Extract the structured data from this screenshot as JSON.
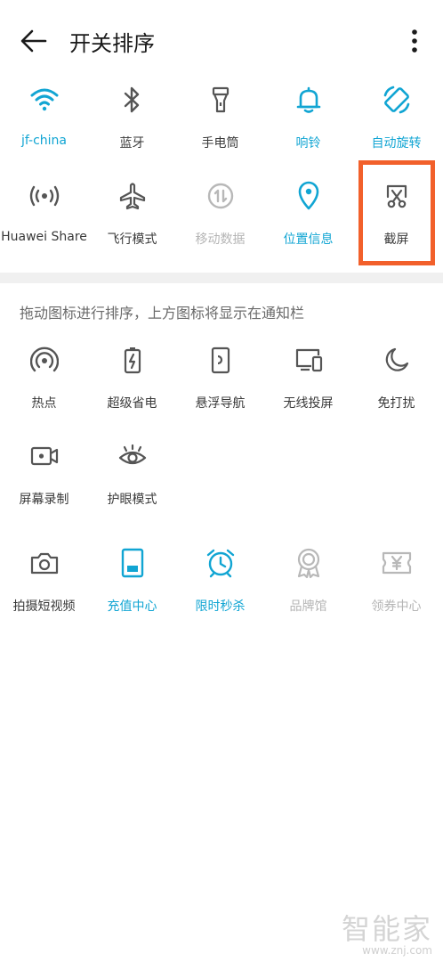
{
  "header": {
    "title": "开关排序"
  },
  "active_tiles": [
    {
      "label": "jf-china",
      "icon": "wifi-icon",
      "state": "active"
    },
    {
      "label": "蓝牙",
      "icon": "bluetooth-icon",
      "state": "normal"
    },
    {
      "label": "手电筒",
      "icon": "flashlight-icon",
      "state": "normal"
    },
    {
      "label": "响铃",
      "icon": "bell-icon",
      "state": "active"
    },
    {
      "label": "自动旋转",
      "icon": "auto-rotate-icon",
      "state": "active"
    },
    {
      "label": "Huawei Share",
      "icon": "huawei-share-icon",
      "state": "normal"
    },
    {
      "label": "飞行模式",
      "icon": "airplane-icon",
      "state": "normal"
    },
    {
      "label": "移动数据",
      "icon": "mobile-data-icon",
      "state": "disabled"
    },
    {
      "label": "位置信息",
      "icon": "location-icon",
      "state": "active"
    },
    {
      "label": "截屏",
      "icon": "screenshot-icon",
      "state": "normal"
    }
  ],
  "hint": "拖动图标进行排序，上方图标将显示在通知栏",
  "inactive_tiles": [
    {
      "label": "热点",
      "icon": "hotspot-icon",
      "state": "normal"
    },
    {
      "label": "超级省电",
      "icon": "battery-saver-icon",
      "state": "normal"
    },
    {
      "label": "悬浮导航",
      "icon": "floating-nav-icon",
      "state": "normal"
    },
    {
      "label": "无线投屏",
      "icon": "wireless-projection-icon",
      "state": "normal"
    },
    {
      "label": "免打扰",
      "icon": "moon-icon",
      "state": "normal"
    },
    {
      "label": "屏幕录制",
      "icon": "screen-record-icon",
      "state": "normal"
    },
    {
      "label": "护眼模式",
      "icon": "eye-comfort-icon",
      "state": "normal"
    }
  ],
  "app_tiles": [
    {
      "label": "拍摄短视频",
      "icon": "camera-icon",
      "state": "normal"
    },
    {
      "label": "充值中心",
      "icon": "recharge-icon",
      "state": "active"
    },
    {
      "label": "限时秒杀",
      "icon": "alarm-clock-icon",
      "state": "active"
    },
    {
      "label": "品牌馆",
      "icon": "brand-medal-icon",
      "state": "disabled"
    },
    {
      "label": "领券中心",
      "icon": "coupon-icon",
      "state": "disabled"
    }
  ],
  "watermark": {
    "logo": "智能家",
    "url": "www.znj.com"
  },
  "colors": {
    "active": "#11a5d3",
    "normal": "#555555",
    "disabled": "#b8b8b8",
    "highlight": "#f2602b"
  }
}
